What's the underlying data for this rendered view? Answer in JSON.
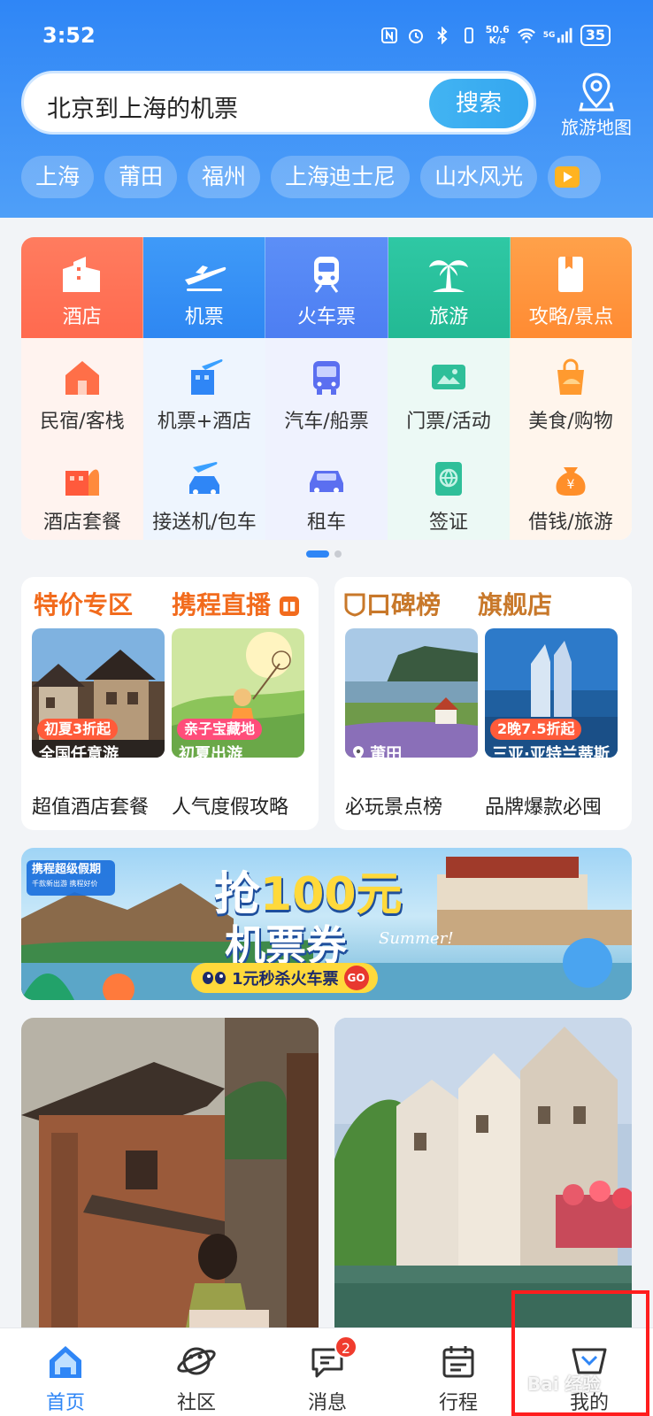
{
  "status_bar": {
    "time": "3:52",
    "net_speed_value": "50.6",
    "net_speed_unit": "K/s",
    "network": "5G",
    "battery": "35"
  },
  "search": {
    "text": "北京到上海的机票",
    "button": "搜索"
  },
  "map_button": {
    "label": "旅游地图",
    "icon": "map-pin-icon"
  },
  "chips": [
    "上海",
    "莆田",
    "福州",
    "上海迪士尼",
    "山水风光"
  ],
  "grid": {
    "top": [
      {
        "label": "酒店",
        "icon": "hotel-icon",
        "color": "#ff6f52"
      },
      {
        "label": "机票",
        "icon": "airplane-icon",
        "color": "#3590f5"
      },
      {
        "label": "火车票",
        "icon": "train-icon",
        "color": "#5585f4"
      },
      {
        "label": "旅游",
        "icon": "palm-tree-icon",
        "color": "#27bf9b"
      },
      {
        "label": "攻略/景点",
        "icon": "guidebook-icon",
        "color": "#ff953b"
      }
    ],
    "row2": [
      {
        "label": "民宿/客栈",
        "icon": "homestay-icon"
      },
      {
        "label": "机票+酒店",
        "icon": "flight-hotel-icon"
      },
      {
        "label": "汽车/船票",
        "icon": "bus-icon"
      },
      {
        "label": "门票/活动",
        "icon": "ticket-icon"
      },
      {
        "label": "美食/购物",
        "icon": "shopping-bag-icon"
      }
    ],
    "row3": [
      {
        "label": "酒店套餐",
        "icon": "hotel-package-icon"
      },
      {
        "label": "接送机/包车",
        "icon": "airport-transfer-icon"
      },
      {
        "label": "租车",
        "icon": "car-icon"
      },
      {
        "label": "签证",
        "icon": "visa-globe-icon"
      },
      {
        "label": "借钱/旅游",
        "icon": "money-bag-icon"
      }
    ]
  },
  "promo_left": {
    "title1": "特价专区",
    "title2": "携程直播",
    "tile1": {
      "badge": "初夏3折起",
      "caption": "全国任意游"
    },
    "tile2": {
      "badge": "亲子宝藏地",
      "caption": "初夏出游"
    },
    "sub1": "超值酒店套餐",
    "sub2": "人气度假攻略"
  },
  "promo_right": {
    "title1": "口碑榜",
    "title2": "旗舰店",
    "tile1": {
      "caption": "莆田"
    },
    "tile2": {
      "badge": "2晚7.5折起",
      "caption": "三亚·亚特兰蒂斯"
    },
    "sub1": "必玩景点榜",
    "sub2": "品牌爆款必囤"
  },
  "banner": {
    "tag_line1": "携程超级假期",
    "tag_line2": "千款新出游 携程好价",
    "main_prefix": "抢",
    "main_amount": "100元",
    "main_line2": "机票券",
    "summer": "Summer!",
    "pill": "1元秒杀火车票",
    "go": "GO"
  },
  "bottom_nav": [
    {
      "label": "首页",
      "icon": "home-icon",
      "active": true
    },
    {
      "label": "社区",
      "icon": "planet-icon"
    },
    {
      "label": "消息",
      "icon": "message-icon",
      "badge": "2"
    },
    {
      "label": "行程",
      "icon": "calendar-icon"
    },
    {
      "label": "我的",
      "icon": "profile-icon"
    }
  ],
  "watermark": "Bai 经验",
  "colors": {
    "primary": "#2f86f6",
    "orange_title": "#f26b1d",
    "highlight_box": "#ff1d1d"
  }
}
